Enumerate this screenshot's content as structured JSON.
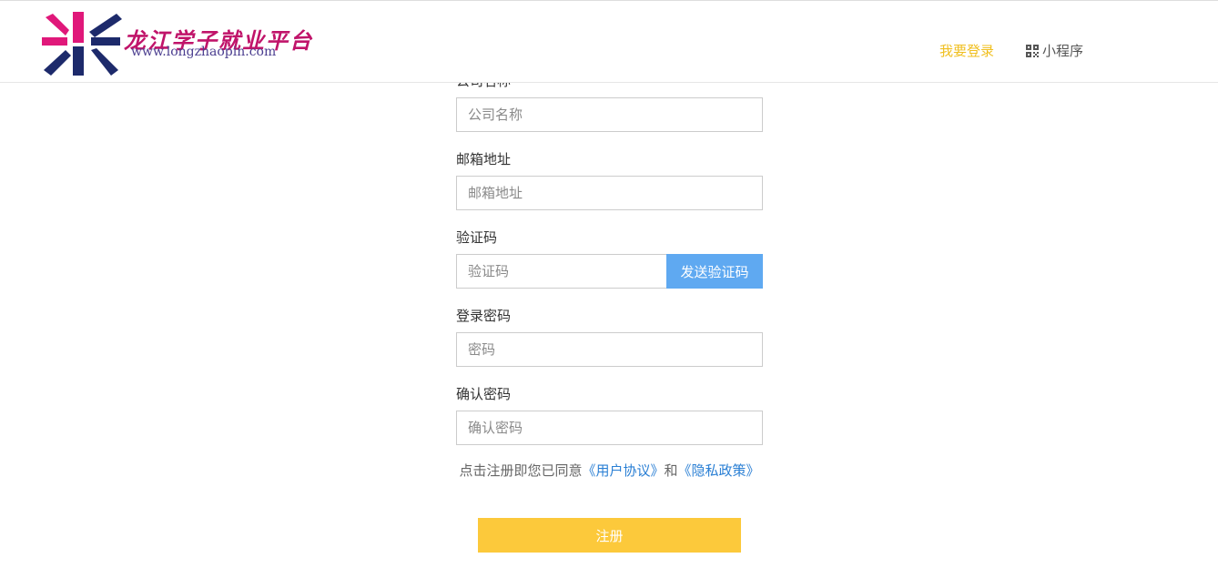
{
  "header": {
    "logo_title": "龙江学子就业平台",
    "logo_url": "www.longzhaopin.com",
    "login_link": "我要登录",
    "miniprogram_link": "小程序"
  },
  "form": {
    "company_label": "公司名称",
    "company_placeholder": "公司名称",
    "email_label": "邮箱地址",
    "email_placeholder": "邮箱地址",
    "code_label": "验证码",
    "code_placeholder": "验证码",
    "send_code_button": "发送验证码",
    "password_label": "登录密码",
    "password_placeholder": "密码",
    "confirm_label": "确认密码",
    "confirm_placeholder": "确认密码",
    "agree_prefix": "点击注册即您已同意",
    "user_agreement": "《用户协议》",
    "agree_and": "和",
    "privacy_policy": "《隐私政策》",
    "submit_button": "注册"
  },
  "colors": {
    "accent_yellow": "#fcc93b",
    "login_link": "#f0bf1f",
    "send_button": "#5fa9f1",
    "link_blue": "#2a7fd4",
    "logo_pink": "#e0187a",
    "logo_navy": "#1d2a6b"
  }
}
